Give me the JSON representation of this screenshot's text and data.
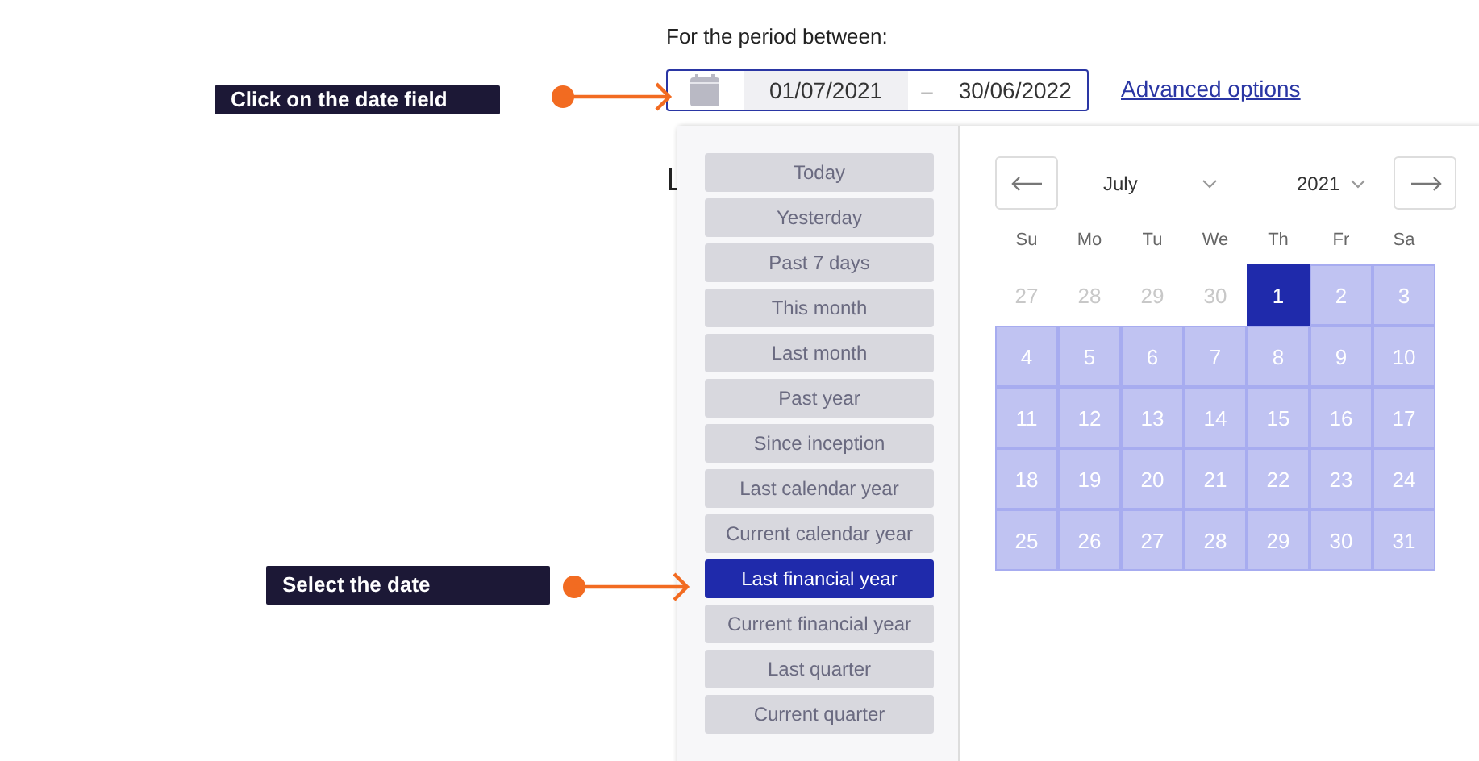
{
  "period_label": "For the period between:",
  "date_field": {
    "start": "01/07/2021",
    "separator": "–",
    "end": "30/06/2022"
  },
  "advanced_link": "Advanced options",
  "background_fragments": [
    "L"
  ],
  "presets": [
    {
      "label": "Today",
      "selected": false
    },
    {
      "label": "Yesterday",
      "selected": false
    },
    {
      "label": "Past 7 days",
      "selected": false
    },
    {
      "label": "This month",
      "selected": false
    },
    {
      "label": "Last month",
      "selected": false
    },
    {
      "label": "Past year",
      "selected": false
    },
    {
      "label": "Since inception",
      "selected": false
    },
    {
      "label": "Last calendar year",
      "selected": false
    },
    {
      "label": "Current calendar year",
      "selected": false
    },
    {
      "label": "Last financial year",
      "selected": true
    },
    {
      "label": "Current financial year",
      "selected": false
    },
    {
      "label": "Last quarter",
      "selected": false
    },
    {
      "label": "Current quarter",
      "selected": false
    }
  ],
  "calendar": {
    "month": "July",
    "year": "2021",
    "weekdays": [
      "Su",
      "Mo",
      "Tu",
      "We",
      "Th",
      "Fr",
      "Sa"
    ],
    "days": [
      {
        "label": "27",
        "outside": true,
        "in_range": false,
        "selected": false
      },
      {
        "label": "28",
        "outside": true,
        "in_range": false,
        "selected": false
      },
      {
        "label": "29",
        "outside": true,
        "in_range": false,
        "selected": false
      },
      {
        "label": "30",
        "outside": true,
        "in_range": false,
        "selected": false
      },
      {
        "label": "1",
        "outside": false,
        "in_range": true,
        "selected": true
      },
      {
        "label": "2",
        "outside": false,
        "in_range": true,
        "selected": false
      },
      {
        "label": "3",
        "outside": false,
        "in_range": true,
        "selected": false
      },
      {
        "label": "4",
        "outside": false,
        "in_range": true,
        "selected": false
      },
      {
        "label": "5",
        "outside": false,
        "in_range": true,
        "selected": false
      },
      {
        "label": "6",
        "outside": false,
        "in_range": true,
        "selected": false
      },
      {
        "label": "7",
        "outside": false,
        "in_range": true,
        "selected": false
      },
      {
        "label": "8",
        "outside": false,
        "in_range": true,
        "selected": false
      },
      {
        "label": "9",
        "outside": false,
        "in_range": true,
        "selected": false
      },
      {
        "label": "10",
        "outside": false,
        "in_range": true,
        "selected": false
      },
      {
        "label": "11",
        "outside": false,
        "in_range": true,
        "selected": false
      },
      {
        "label": "12",
        "outside": false,
        "in_range": true,
        "selected": false
      },
      {
        "label": "13",
        "outside": false,
        "in_range": true,
        "selected": false
      },
      {
        "label": "14",
        "outside": false,
        "in_range": true,
        "selected": false
      },
      {
        "label": "15",
        "outside": false,
        "in_range": true,
        "selected": false
      },
      {
        "label": "16",
        "outside": false,
        "in_range": true,
        "selected": false
      },
      {
        "label": "17",
        "outside": false,
        "in_range": true,
        "selected": false
      },
      {
        "label": "18",
        "outside": false,
        "in_range": true,
        "selected": false
      },
      {
        "label": "19",
        "outside": false,
        "in_range": true,
        "selected": false
      },
      {
        "label": "20",
        "outside": false,
        "in_range": true,
        "selected": false
      },
      {
        "label": "21",
        "outside": false,
        "in_range": true,
        "selected": false
      },
      {
        "label": "22",
        "outside": false,
        "in_range": true,
        "selected": false
      },
      {
        "label": "23",
        "outside": false,
        "in_range": true,
        "selected": false
      },
      {
        "label": "24",
        "outside": false,
        "in_range": true,
        "selected": false
      },
      {
        "label": "25",
        "outside": false,
        "in_range": true,
        "selected": false
      },
      {
        "label": "26",
        "outside": false,
        "in_range": true,
        "selected": false
      },
      {
        "label": "27",
        "outside": false,
        "in_range": true,
        "selected": false
      },
      {
        "label": "28",
        "outside": false,
        "in_range": true,
        "selected": false
      },
      {
        "label": "29",
        "outside": false,
        "in_range": true,
        "selected": false
      },
      {
        "label": "30",
        "outside": false,
        "in_range": true,
        "selected": false
      },
      {
        "label": "31",
        "outside": false,
        "in_range": true,
        "selected": false
      }
    ]
  },
  "callouts": [
    {
      "text": "Click on the date field"
    },
    {
      "text": "Select the date"
    }
  ]
}
